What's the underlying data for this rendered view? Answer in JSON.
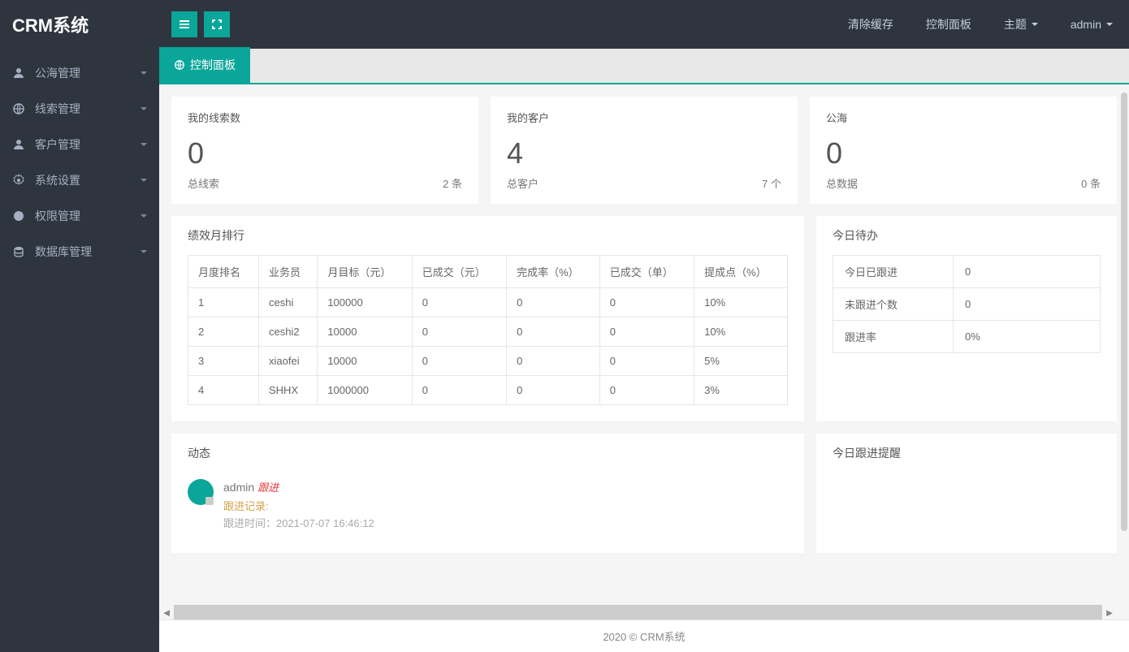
{
  "header": {
    "logo": "CRM系统",
    "links": {
      "clear_cache": "清除缓存",
      "control_panel": "控制面板",
      "theme": "主题",
      "user": "admin"
    }
  },
  "sidebar": {
    "items": [
      {
        "label": "公海管理"
      },
      {
        "label": "线索管理"
      },
      {
        "label": "客户管理"
      },
      {
        "label": "系统设置"
      },
      {
        "label": "权限管理"
      },
      {
        "label": "数据库管理"
      }
    ]
  },
  "tab": {
    "label": "控制面板"
  },
  "stats": [
    {
      "title": "我的线索数",
      "value": "0",
      "foot_label": "总线索",
      "foot_value": "2 条"
    },
    {
      "title": "我的客户",
      "value": "4",
      "foot_label": "总客户",
      "foot_value": "7 个"
    },
    {
      "title": "公海",
      "value": "0",
      "foot_label": "总数据",
      "foot_value": "0 条"
    }
  ],
  "rank": {
    "title": "绩效月排行",
    "headers": [
      "月度排名",
      "业务员",
      "月目标（元）",
      "已成交（元）",
      "完成率（%）",
      "已成交（单）",
      "提成点（%）"
    ],
    "rows": [
      [
        "1",
        "ceshi",
        "100000",
        "0",
        "0",
        "0",
        "10%"
      ],
      [
        "2",
        "ceshi2",
        "10000",
        "0",
        "0",
        "0",
        "10%"
      ],
      [
        "3",
        "xiaofei",
        "10000",
        "0",
        "0",
        "0",
        "5%"
      ],
      [
        "4",
        "SHHX",
        "1000000",
        "0",
        "0",
        "0",
        "3%"
      ]
    ]
  },
  "todo": {
    "title": "今日待办",
    "rows": [
      {
        "label": "今日已跟进",
        "value": "0"
      },
      {
        "label": "未跟进个数",
        "value": "0"
      },
      {
        "label": "跟进率",
        "value": "0%"
      }
    ]
  },
  "activity": {
    "title": "动态",
    "user": "admin",
    "action": "跟进",
    "record_label": "跟进记录:",
    "time_label": "跟进时间：2021-07-07 16:46:12"
  },
  "reminder": {
    "title": "今日跟进提醒"
  },
  "footer": {
    "text": "2020 ©    CRM系统"
  }
}
